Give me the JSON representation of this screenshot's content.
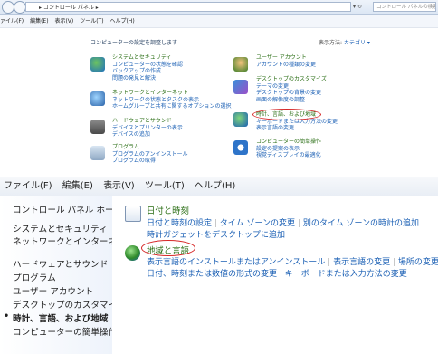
{
  "top": {
    "breadcrumb": "▸ コントロール パネル ▸",
    "search_placeholder": "コントロール パネルの検索",
    "menu": [
      "ァイル(F)",
      "編集(E)",
      "表示(V)",
      "ツール(T)",
      "ヘルプ(H)"
    ],
    "heading": "コンピューターの設定を調整します",
    "view_label": "表示方法:",
    "view_value": "カテゴリ ▾",
    "left_categories": [
      {
        "title": "システムとセキュリティ",
        "links": [
          "コンピューターの状態を確認",
          "バックアップの作成",
          "問題の発見と解決"
        ]
      },
      {
        "title": "ネットワークとインターネット",
        "links": [
          "ネットワークの状態とタスクの表示",
          "ホームグループと共有に関するオプションの選択"
        ]
      },
      {
        "title": "ハードウェアとサウンド",
        "links": [
          "デバイスとプリンターの表示",
          "デバイスの追加"
        ]
      },
      {
        "title": "プログラム",
        "links": [
          "プログラムのアンインストール",
          "プログラムの取得"
        ]
      }
    ],
    "right_categories": [
      {
        "title": "ユーザー アカウント",
        "links": [
          "アカウントの種類の変更"
        ]
      },
      {
        "title": "デスクトップのカスタマイズ",
        "links": [
          "テーマの変更",
          "デスクトップの背景の変更",
          "画面の解像度の調整"
        ]
      },
      {
        "title": "時計、言語、および地域",
        "links": [
          "キーボードまたは入力方法の変更",
          "表示言語の変更"
        ]
      },
      {
        "title": "コンピューターの簡単操作",
        "links": [
          "設定の提案の表示",
          "視覚ディスプレイの最適化"
        ]
      }
    ]
  },
  "menubar": [
    "ファイル(F)",
    "編集(E)",
    "表示(V)",
    "ツール(T)",
    "ヘルプ(H)"
  ],
  "sidebar": {
    "home": "コントロール パネル ホーム",
    "items": [
      "システムとセキュリティ",
      "ネットワークとインターネット",
      "ハードウェアとサウンド",
      "プログラム",
      "ユーザー アカウント",
      "デスクトップのカスタマイズ",
      "時計、言語、および地域",
      "コンピューターの簡単操作"
    ],
    "active_index": 6,
    "bullet": "•"
  },
  "content": {
    "datetime": {
      "title": "日付と時刻",
      "row1": [
        "日付と時刻の設定",
        "タイム ゾーンの変更",
        "別のタイム ゾーンの時計の追加"
      ],
      "row2": [
        "時計ガジェットをデスクトップに追加"
      ]
    },
    "region": {
      "title": "地域と言語",
      "row1": [
        "表示言語のインストールまたはアンインストール",
        "表示言語の変更",
        "場所の変更"
      ],
      "row2": [
        "日付、時刻または数値の形式の変更",
        "キーボードまたは入力方法の変更"
      ]
    }
  },
  "colors": {
    "link": "#1a5fb4",
    "heading": "#2a6e14",
    "highlight_ring": "#d62828"
  }
}
